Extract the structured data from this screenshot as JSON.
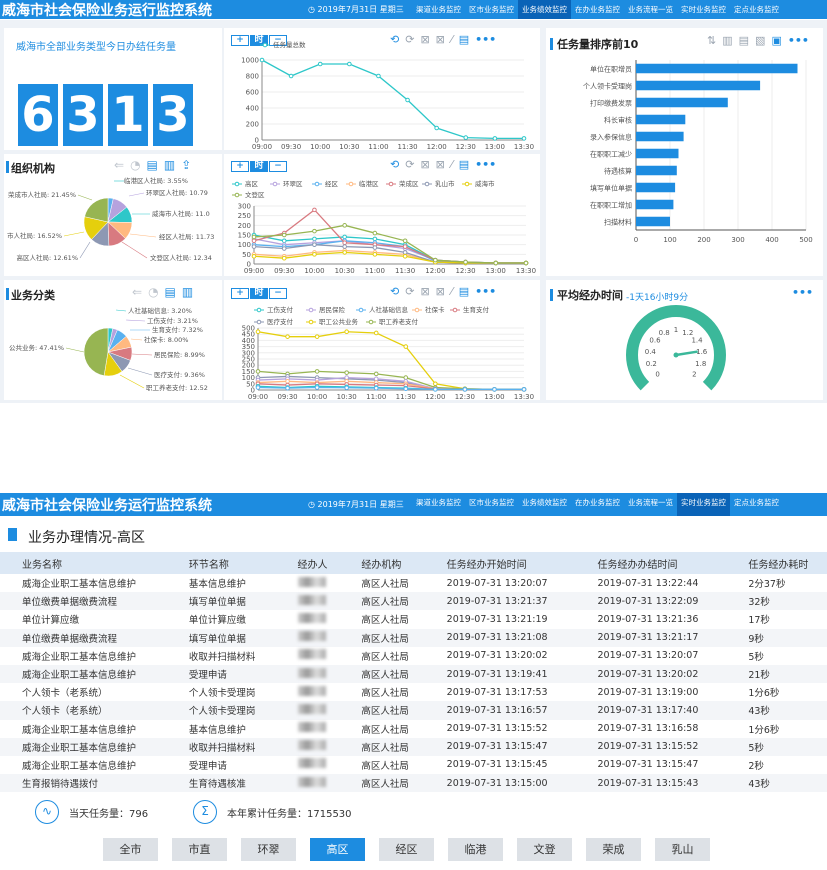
{
  "app": {
    "title": "威海市社会保险业务运行监控系统",
    "date": "2019年7月31日 星期三",
    "nav_top": [
      "渠道业务监控",
      "区市业务监控",
      "业务绩效监控",
      "在办业务监控",
      "业务流程一览",
      "实时业务监控",
      "定点业务监控"
    ],
    "nav_top_active": 2,
    "nav_bottom": [
      "渠道业务监控",
      "区市业务监控",
      "业务绩效监控",
      "在办业务监控",
      "业务流程一览",
      "实时业务监控",
      "定点业务监控"
    ],
    "nav_bottom_active": 5
  },
  "colors": {
    "primary": "#1d8ce0",
    "header_active": "#0a63b7",
    "gauge": "#3bb89a"
  },
  "icons": [
    "clock-icon",
    "plus-icon",
    "minus-icon",
    "refresh-icon",
    "save-icon",
    "list-icon",
    "bar-chart-icon",
    "line-chart-icon",
    "more-icon",
    "sort-icon",
    "data-view-icon",
    "pulse-icon",
    "sigma-icon",
    "bookmark-icon"
  ],
  "today": {
    "title": "威海市全部业务类型今日办结任务量",
    "digits": [
      "6",
      "3",
      "1",
      "3"
    ],
    "zoom": {
      "plus": "+",
      "time": "时",
      "minus": "−"
    }
  },
  "org": {
    "title": "组织机构"
  },
  "biz": {
    "title": "业务分类"
  },
  "top10": {
    "title": "任务量排序前10"
  },
  "avg": {
    "title": "平均经办时间",
    "value": "-1天16小时9分"
  },
  "chart_data": [
    {
      "id": "total-line",
      "type": "line",
      "series": [
        {
          "name": "任务量总数",
          "values": [
            1000,
            800,
            950,
            950,
            800,
            500,
            150,
            30,
            20,
            20
          ]
        }
      ],
      "x": [
        "09:00",
        "09:30",
        "10:00",
        "10:30",
        "11:00",
        "11:30",
        "12:00",
        "12:30",
        "13:00",
        "13:30"
      ],
      "ylim": [
        0,
        1000
      ],
      "yticks": [
        0,
        200,
        400,
        600,
        800,
        1000
      ],
      "xticks": [
        "09:00",
        "09:30",
        "10:00",
        "10:30",
        "11:00",
        "11:30",
        "12:00",
        "12:30",
        "13:00",
        "13:30"
      ]
    },
    {
      "id": "org-pie",
      "type": "pie",
      "slices": [
        {
          "label": "临港区人社局",
          "value": 3.55,
          "color": "#5ab1ef"
        },
        {
          "label": "环翠区人社局",
          "value": 10.79,
          "color": "#b6a2de"
        },
        {
          "label": "威海市人社局",
          "value": 11.0,
          "color": "#2ec7c9"
        },
        {
          "label": "经区人社局",
          "value": 11.73,
          "color": "#ffb980"
        },
        {
          "label": "文登区人社局",
          "value": 12.34,
          "color": "#d87a80"
        },
        {
          "label": "高区人社局",
          "value": 12.61,
          "color": "#8d98b3"
        },
        {
          "label": "威海市人社局",
          "value": 16.52,
          "color": "#e5cf0d"
        },
        {
          "label": "荣成市人社局",
          "value": 21.45,
          "color": "#97b552"
        }
      ],
      "labels": [
        "临港区人社局: 3.55%",
        "环翠区人社局: 10.79",
        "威海市人社局: 11.0",
        "经区人社局: 11.73",
        "文登区人社局: 12.34",
        "高区人社局: 12.61%",
        "市人社局: 16.52%",
        "荣成市人社局: 21.45%"
      ]
    },
    {
      "id": "org-line",
      "type": "line",
      "x": [
        "09:00",
        "09:30",
        "10:00",
        "10:30",
        "11:00",
        "11:30",
        "12:00",
        "12:30",
        "13:00",
        "13:30"
      ],
      "ylim": [
        0,
        300
      ],
      "yticks": [
        0,
        50,
        100,
        150,
        200,
        250,
        300
      ],
      "legend": [
        "高区",
        "环翠区",
        "经区",
        "临港区",
        "荣成区",
        "乳山市",
        "威海市",
        "文登区"
      ],
      "series": [
        {
          "name": "高区",
          "color": "#2ec7c9",
          "values": [
            150,
            120,
            130,
            140,
            130,
            100,
            20,
            10,
            5,
            5
          ]
        },
        {
          "name": "环翠区",
          "color": "#b6a2de",
          "values": [
            130,
            100,
            110,
            120,
            100,
            80,
            20,
            10,
            5,
            5
          ]
        },
        {
          "name": "经区",
          "color": "#5ab1ef",
          "values": [
            100,
            90,
            100,
            120,
            110,
            90,
            15,
            5,
            5,
            5
          ]
        },
        {
          "name": "临港区",
          "color": "#ffb980",
          "values": [
            50,
            40,
            60,
            70,
            60,
            50,
            10,
            5,
            5,
            5
          ]
        },
        {
          "name": "荣成区",
          "color": "#d87a80",
          "values": [
            120,
            160,
            280,
            110,
            100,
            90,
            20,
            10,
            5,
            5
          ]
        },
        {
          "name": "乳山市",
          "color": "#8d98b3",
          "values": [
            90,
            80,
            100,
            90,
            85,
            60,
            10,
            5,
            5,
            5
          ]
        },
        {
          "name": "威海市",
          "color": "#e5cf0d",
          "values": [
            40,
            30,
            50,
            60,
            50,
            40,
            10,
            5,
            5,
            5
          ]
        },
        {
          "name": "文登区",
          "color": "#97b552",
          "values": [
            140,
            150,
            170,
            200,
            160,
            120,
            20,
            10,
            5,
            5
          ]
        }
      ]
    },
    {
      "id": "biz-pie",
      "type": "pie",
      "slices": [
        {
          "label": "人社基础信息",
          "value": 3.2,
          "color": "#2ec7c9"
        },
        {
          "label": "工伤支付",
          "value": 3.21,
          "color": "#b6a2de"
        },
        {
          "label": "生育支付",
          "value": 7.32,
          "color": "#5ab1ef"
        },
        {
          "label": "社保卡",
          "value": 8.0,
          "color": "#ffb980"
        },
        {
          "label": "居民保险",
          "value": 8.99,
          "color": "#d87a80"
        },
        {
          "label": "医疗支付",
          "value": 9.36,
          "color": "#8d98b3"
        },
        {
          "label": "职工养老支付",
          "value": 12.52,
          "color": "#e5cf0d"
        },
        {
          "label": "职工公共业务",
          "value": 47.41,
          "color": "#97b552"
        }
      ],
      "labels": [
        "人社基础信息: 3.20%",
        "工伤支付: 3.21%",
        "生育支付: 7.32%",
        "社保卡: 8.00%",
        "居民保险: 8.99%",
        "医疗支付: 9.36%",
        "职工养老支付: 12.52",
        "公共业务: 47.41%"
      ]
    },
    {
      "id": "biz-line",
      "type": "line",
      "x": [
        "09:00",
        "09:30",
        "10:00",
        "10:30",
        "11:00",
        "11:30",
        "12:00",
        "12:30",
        "13:00",
        "13:30"
      ],
      "ylim": [
        0,
        500
      ],
      "yticks": [
        0,
        50,
        100,
        150,
        200,
        250,
        300,
        350,
        400,
        450,
        500
      ],
      "legend": [
        "工伤支付",
        "居民保险",
        "人社基础信息",
        "社保卡",
        "生育支付",
        "医疗支付",
        "职工公共业务",
        "职工养老支付"
      ],
      "series": [
        {
          "name": "职工公共业务",
          "color": "#e5cf0d",
          "values": [
            470,
            430,
            430,
            470,
            460,
            350,
            50,
            10,
            5,
            5
          ]
        },
        {
          "name": "职工养老支付",
          "color": "#97b552",
          "values": [
            150,
            130,
            150,
            140,
            130,
            100,
            20,
            10,
            5,
            5
          ]
        },
        {
          "name": "医疗支付",
          "color": "#8d98b3",
          "values": [
            100,
            110,
            100,
            90,
            80,
            60,
            10,
            5,
            5,
            5
          ]
        },
        {
          "name": "居民保险",
          "color": "#b6a2de",
          "values": [
            80,
            90,
            80,
            100,
            90,
            70,
            10,
            5,
            5,
            5
          ]
        },
        {
          "name": "社保卡",
          "color": "#ffb980",
          "values": [
            60,
            70,
            60,
            70,
            60,
            50,
            10,
            5,
            5,
            5
          ]
        },
        {
          "name": "生育支付",
          "color": "#d87a80",
          "values": [
            50,
            40,
            50,
            45,
            40,
            35,
            8,
            5,
            5,
            5
          ]
        },
        {
          "name": "工伤支付",
          "color": "#2ec7c9",
          "values": [
            30,
            20,
            30,
            25,
            20,
            15,
            5,
            5,
            5,
            5
          ]
        },
        {
          "name": "人社基础信息",
          "color": "#5ab1ef",
          "values": [
            20,
            15,
            20,
            18,
            15,
            10,
            5,
            5,
            5,
            5
          ]
        }
      ]
    },
    {
      "id": "top10-bar",
      "type": "bar",
      "categories": [
        "单位在职增员",
        "个人领卡受理岗",
        "打印缴费发票",
        "科长审核",
        "录入参保信息",
        "在职职工减少",
        "待遇核算",
        "填写单位单据",
        "在职职工增加",
        "扫描材料"
      ],
      "values": [
        475,
        365,
        270,
        145,
        140,
        125,
        120,
        115,
        110,
        100
      ],
      "xlim": [
        0,
        500
      ],
      "xticks": [
        0,
        100,
        200,
        300,
        400,
        500
      ]
    },
    {
      "id": "avg-gauge",
      "type": "gauge",
      "ticks": [
        "0",
        "0.2",
        "0.4",
        "0.6",
        "0.8",
        "1",
        "1.2",
        "1.4",
        "1.6",
        "1.8",
        "2"
      ],
      "value": 1.6,
      "range": [
        0,
        2
      ]
    }
  ],
  "detail": {
    "title": "业务办理情况-高区",
    "columns": [
      "业务名称",
      "环节名称",
      "经办人",
      "经办机构",
      "任务经办开始时间",
      "任务经办办结时间",
      "任务经办耗时"
    ],
    "rows": [
      [
        "威海企业职工基本信息维护",
        "基本信息维护",
        "",
        "高区人社局",
        "2019-07-31 13:20:07",
        "2019-07-31 13:22:44",
        "2分37秒"
      ],
      [
        "单位缴费单据缴费流程",
        "填写单位单据",
        "",
        "高区人社局",
        "2019-07-31 13:21:37",
        "2019-07-31 13:22:09",
        "32秒"
      ],
      [
        "单位计算应缴",
        "单位计算应缴",
        "",
        "高区人社局",
        "2019-07-31 13:21:19",
        "2019-07-31 13:21:36",
        "17秒"
      ],
      [
        "单位缴费单据缴费流程",
        "填写单位单据",
        "",
        "高区人社局",
        "2019-07-31 13:21:08",
        "2019-07-31 13:21:17",
        "9秒"
      ],
      [
        "威海企业职工基本信息维护",
        "收取并扫描材料",
        "",
        "高区人社局",
        "2019-07-31 13:20:02",
        "2019-07-31 13:20:07",
        "5秒"
      ],
      [
        "威海企业职工基本信息维护",
        "受理申请",
        "",
        "高区人社局",
        "2019-07-31 13:19:41",
        "2019-07-31 13:20:02",
        "21秒"
      ],
      [
        "个人领卡（老系统）",
        "个人领卡受理岗",
        "",
        "高区人社局",
        "2019-07-31 13:17:53",
        "2019-07-31 13:19:00",
        "1分6秒"
      ],
      [
        "个人领卡（老系统）",
        "个人领卡受理岗",
        "",
        "高区人社局",
        "2019-07-31 13:16:57",
        "2019-07-31 13:17:40",
        "43秒"
      ],
      [
        "威海企业职工基本信息维护",
        "基本信息维护",
        "",
        "高区人社局",
        "2019-07-31 13:15:52",
        "2019-07-31 13:16:58",
        "1分6秒"
      ],
      [
        "威海企业职工基本信息维护",
        "收取并扫描材料",
        "",
        "高区人社局",
        "2019-07-31 13:15:47",
        "2019-07-31 13:15:52",
        "5秒"
      ],
      [
        "威海企业职工基本信息维护",
        "受理申请",
        "",
        "高区人社局",
        "2019-07-31 13:15:45",
        "2019-07-31 13:15:47",
        "2秒"
      ],
      [
        "生育报销待遇拨付",
        "生育待遇核准",
        "",
        "高区人社局",
        "2019-07-31 13:15:00",
        "2019-07-31 13:15:43",
        "43秒"
      ]
    ],
    "today_count": "当天任务量：796",
    "year_count": "本年累计任务量：1715530",
    "districts": [
      "全市",
      "市直",
      "环翠",
      "高区",
      "经区",
      "临港",
      "文登",
      "荣成",
      "乳山"
    ],
    "active_district": 3
  }
}
